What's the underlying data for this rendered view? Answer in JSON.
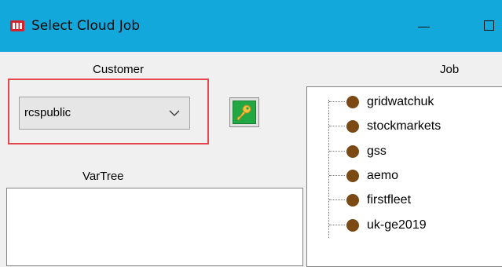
{
  "window": {
    "title": "Select Cloud Job",
    "app_icon": "app-logo-icon",
    "controls": [
      "minimize-icon",
      "maximize-icon"
    ]
  },
  "customer": {
    "label": "Customer",
    "selected": "rcspublic",
    "highlight_color": "#e4464b"
  },
  "login_button": {
    "icon": "key-icon",
    "color": "#22a843"
  },
  "vartree": {
    "label": "VarTree"
  },
  "job": {
    "label": "Job",
    "items": [
      "gridwatchuk",
      "stockmarkets",
      "gss",
      "aemo",
      "firstfleet",
      "uk-ge2019"
    ],
    "item_icon": "node-dot-icon",
    "item_color": "#7b4a14"
  },
  "colors": {
    "titlebar": "#13a8dc",
    "background": "#f0f0f0"
  }
}
